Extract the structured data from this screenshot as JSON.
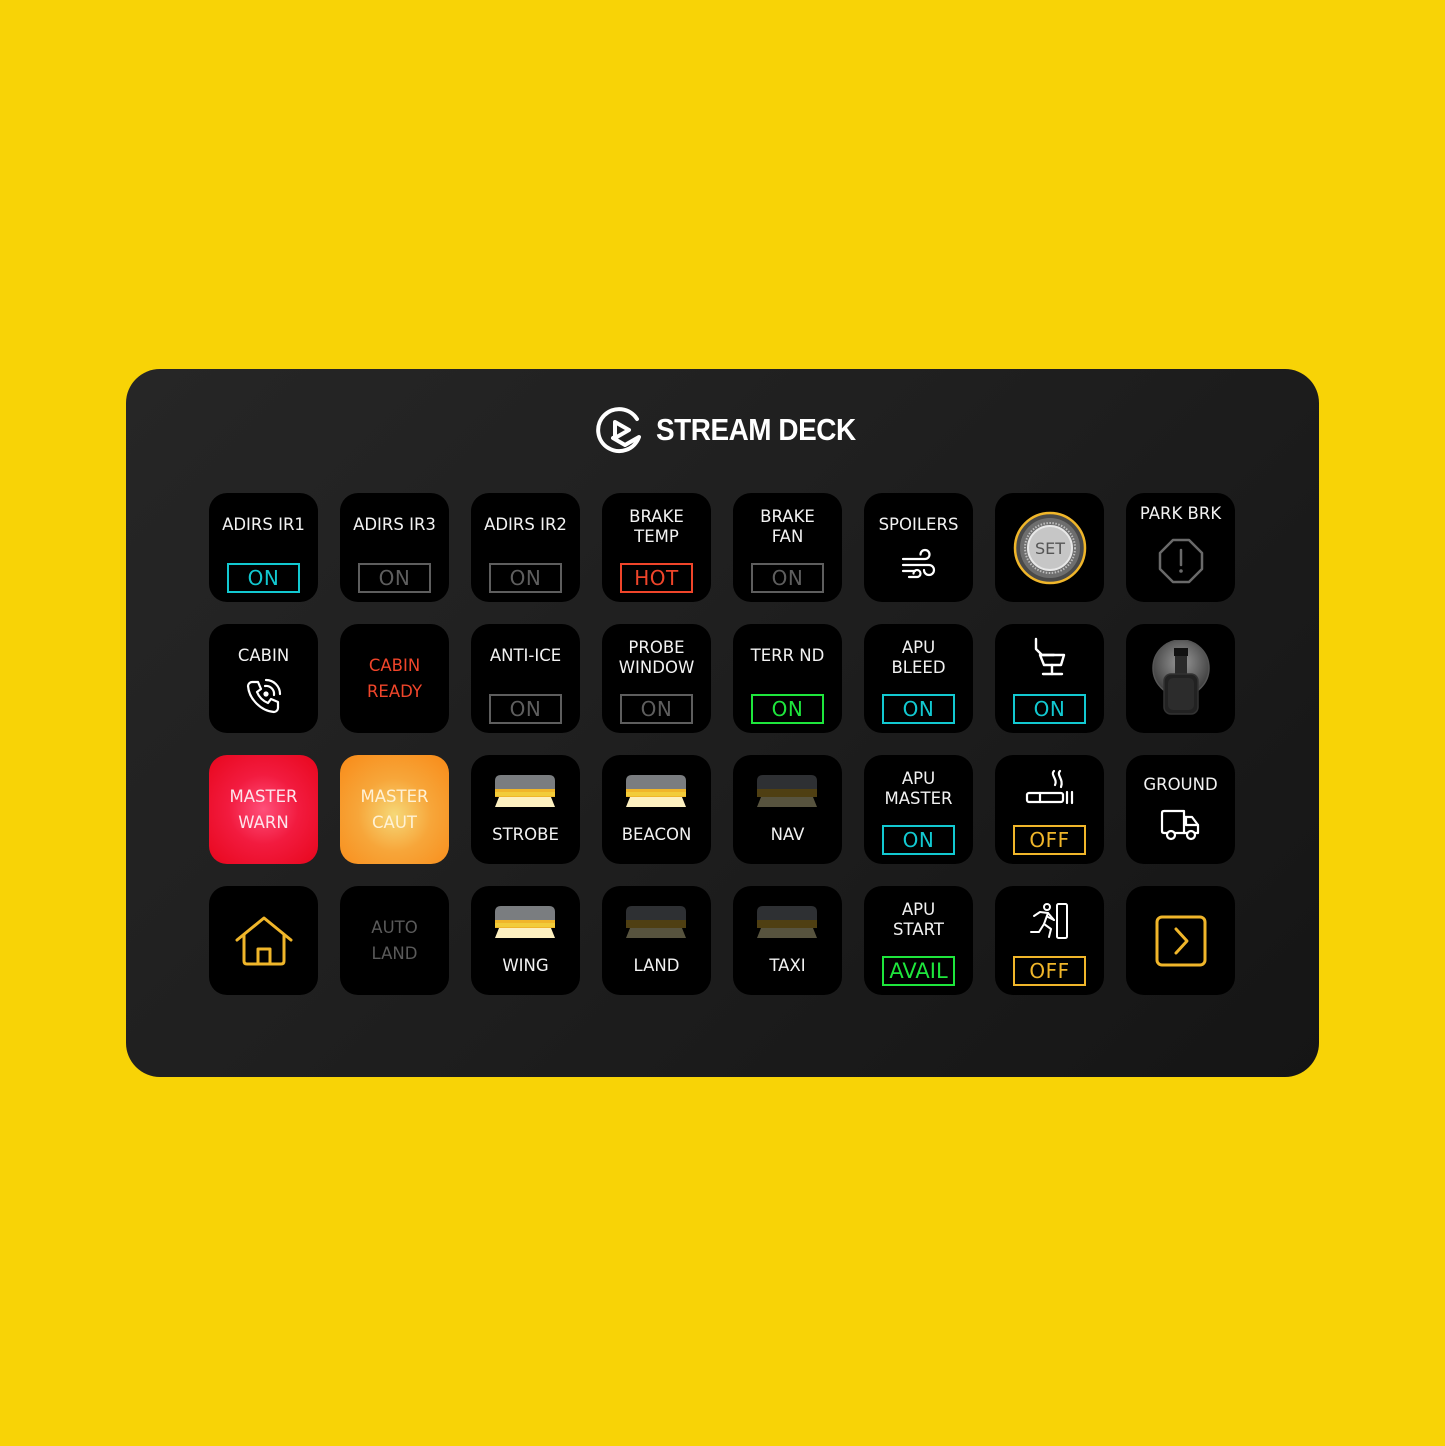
{
  "device": {
    "brand": "STREAM DECK",
    "background_color": "#f8d306"
  },
  "colors": {
    "cyan": "#12c9d1",
    "gray": "#5e5e5e",
    "red": "#f0452a",
    "green": "#1ee63c",
    "amber": "#f0b62a"
  },
  "keys": {
    "adirs_ir1": {
      "label": "ADIRS IR1",
      "state": "ON"
    },
    "adirs_ir3": {
      "label": "ADIRS IR3",
      "state": "ON"
    },
    "adirs_ir2": {
      "label": "ADIRS IR2",
      "state": "ON"
    },
    "brake_temp": {
      "label": "BRAKE\nTEMP",
      "state": "HOT"
    },
    "brake_fan": {
      "label": "BRAKE\nFAN",
      "state": "ON"
    },
    "spoilers": {
      "label": "SPOILERS",
      "icon": "wind-icon"
    },
    "set_knob": {
      "label": "SET",
      "icon": "knob-icon"
    },
    "park_brk": {
      "label": "PARK BRK",
      "icon": "octagon-alert-icon"
    },
    "cabin": {
      "label": "CABIN",
      "icon": "phone-call-icon"
    },
    "cabin_ready": {
      "label": "CABIN\nREADY"
    },
    "anti_ice": {
      "label": "ANTI-ICE",
      "state": "ON"
    },
    "probe_window": {
      "label": "PROBE\nWINDOW",
      "state": "ON"
    },
    "terr_nd": {
      "label": "TERR ND",
      "state": "ON"
    },
    "apu_bleed": {
      "label": "APU\nBLEED",
      "state": "ON"
    },
    "seat_belts": {
      "icon": "seat-icon",
      "state": "ON"
    },
    "toggle_switch": {
      "icon": "toggle-switch-icon"
    },
    "master_warn": {
      "label": "MASTER\nWARN"
    },
    "master_caut": {
      "label": "MASTER\nCAUT"
    },
    "strobe": {
      "label": "STROBE",
      "icon": "light-on-icon"
    },
    "beacon": {
      "label": "BEACON",
      "icon": "light-on-icon"
    },
    "nav": {
      "label": "NAV",
      "icon": "light-off-icon"
    },
    "apu_master": {
      "label": "APU\nMASTER",
      "state": "ON"
    },
    "no_smoking": {
      "icon": "cigarette-icon",
      "state": "OFF"
    },
    "ground": {
      "label": "GROUND",
      "icon": "truck-icon"
    },
    "home": {
      "icon": "home-icon"
    },
    "auto_land": {
      "label": "AUTO\nLAND"
    },
    "wing": {
      "label": "WING",
      "icon": "light-on-icon"
    },
    "land": {
      "label": "LAND",
      "icon": "light-off-icon"
    },
    "taxi": {
      "label": "TAXI",
      "icon": "light-off-icon"
    },
    "apu_start": {
      "label": "APU\nSTART",
      "state": "AVAIL"
    },
    "emer_exit": {
      "icon": "emergency-exit-icon",
      "state": "OFF"
    },
    "next_page": {
      "icon": "chevron-right-icon"
    }
  }
}
